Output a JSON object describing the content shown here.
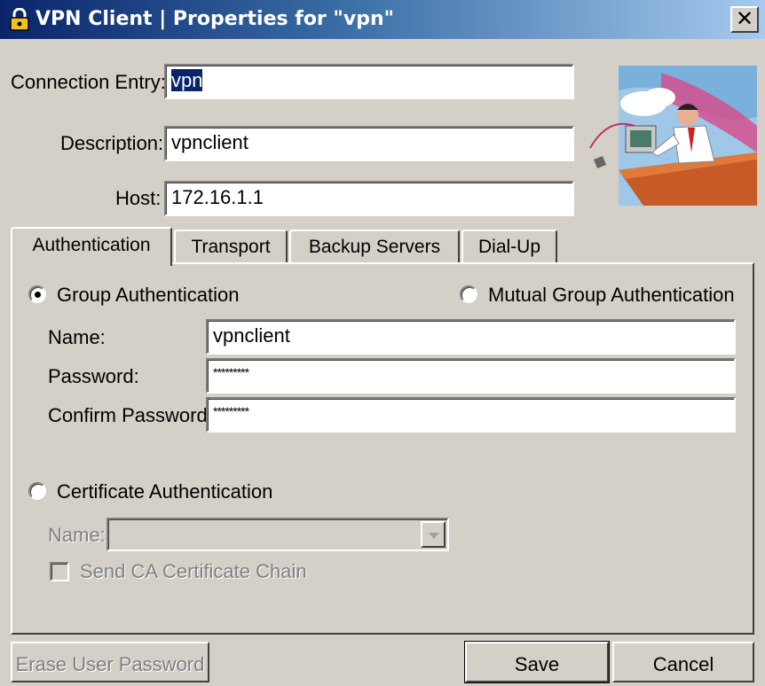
{
  "window": {
    "title": "VPN Client  |  Properties for \"vpn\"",
    "close_glyph": "✕",
    "lock_icon": "lock-icon"
  },
  "form": {
    "connection_entry_label": "Connection Entry:",
    "connection_entry_value": "vpn",
    "description_label": "Description:",
    "description_value": "vpnclient",
    "host_label": "Host:",
    "host_value": "172.16.1.1"
  },
  "tabs": [
    {
      "label": "Authentication",
      "active": true
    },
    {
      "label": "Transport",
      "active": false
    },
    {
      "label": "Backup Servers",
      "active": false
    },
    {
      "label": "Dial-Up",
      "active": false
    }
  ],
  "auth": {
    "group_auth_label": "Group Authentication",
    "group_auth_selected": true,
    "mutual_auth_label": "Mutual Group Authentication",
    "mutual_auth_selected": false,
    "name_label": "Name:",
    "name_value": "vpnclient",
    "password_label": "Password:",
    "password_value": "*********",
    "confirm_password_label": "Confirm Password:",
    "confirm_password_value": "*********",
    "cert_auth_label": "Certificate Authentication",
    "cert_auth_selected": false,
    "cert_name_label": "Name:",
    "cert_name_value": "",
    "send_ca_label": "Send CA Certificate Chain",
    "send_ca_checked": false
  },
  "buttons": {
    "erase_password": "Erase User Password",
    "save": "Save",
    "cancel": "Cancel"
  },
  "colors": {
    "title_gradient_start": "#0a246a",
    "title_gradient_end": "#a6caf0",
    "face": "#d4d0c8",
    "selection": "#0a246a"
  }
}
